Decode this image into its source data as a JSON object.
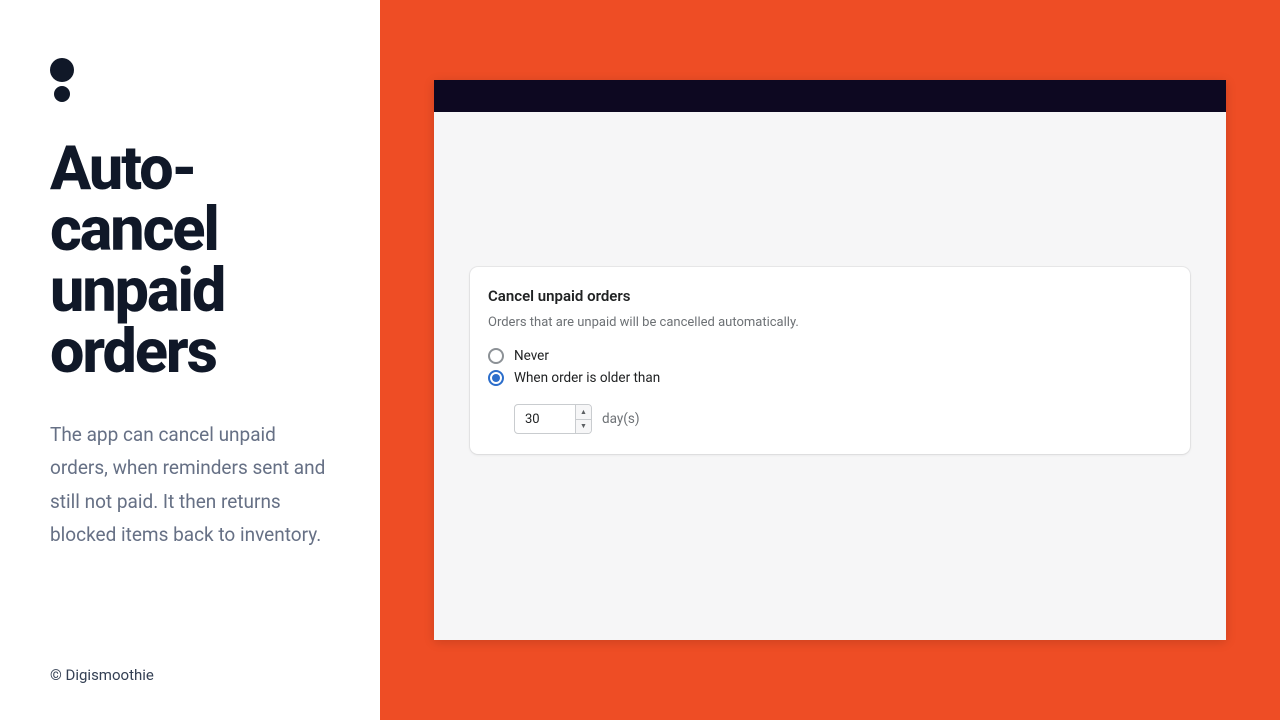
{
  "sidebar": {
    "heading": "Auto-cancel unpaid orders",
    "description": "The app can cancel unpaid orders, when reminders sent and still not paid. It then returns blocked items back to inventory.",
    "copyright": "© Digismoothie"
  },
  "card": {
    "title": "Cancel unpaid orders",
    "subtitle": "Orders that are unpaid will be cancelled automatically.",
    "options": {
      "never": "Never",
      "older_than": "When order is older than"
    },
    "days_value": "30",
    "unit_label": "day(s)"
  }
}
